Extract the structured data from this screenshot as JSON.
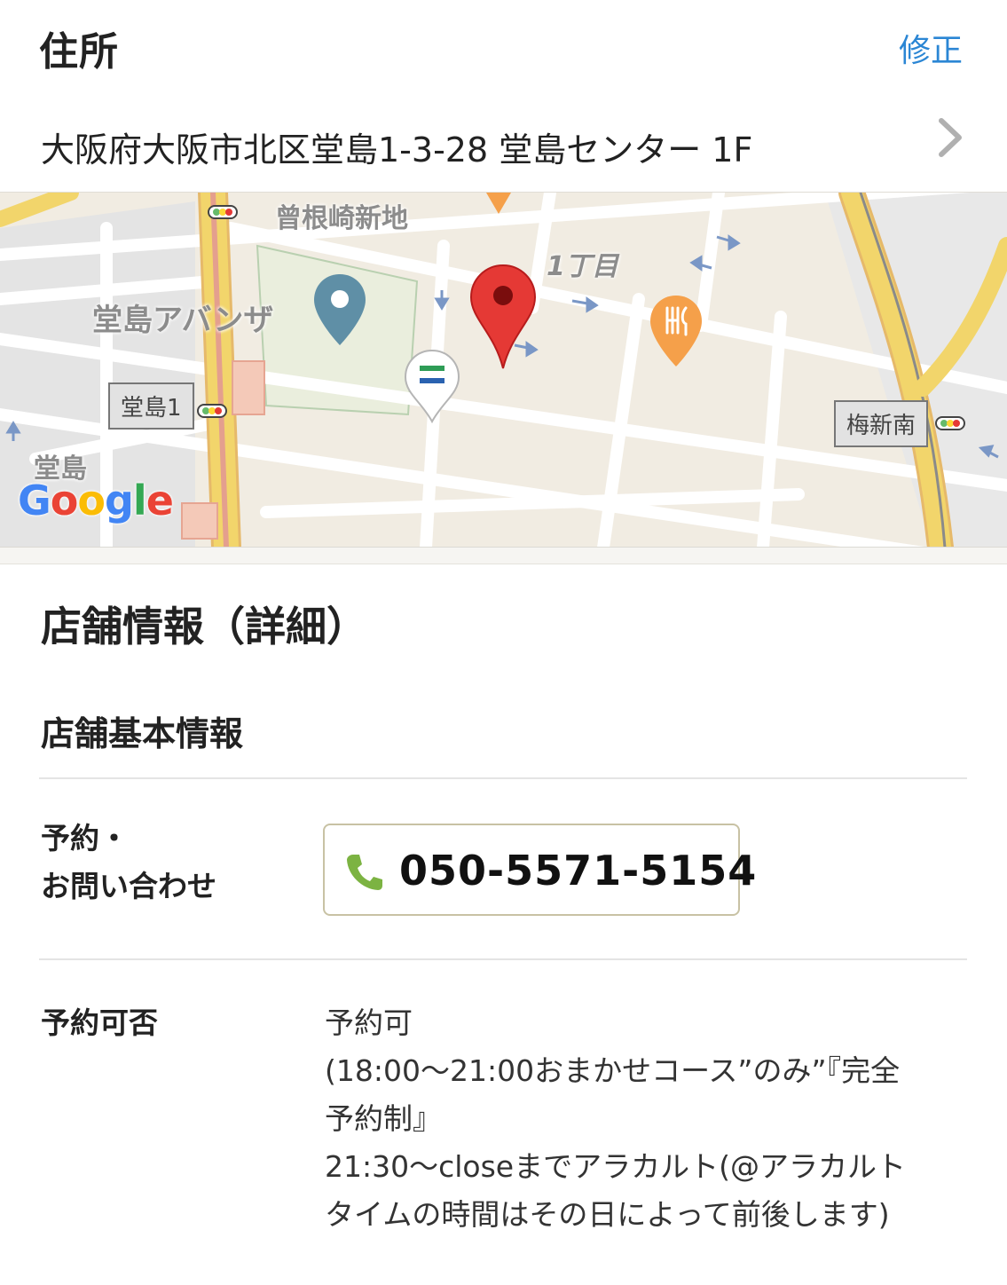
{
  "header": {
    "title": "住所",
    "edit_label": "修正"
  },
  "address": {
    "text": "大阪府大阪市北区堂島1-3-28 堂島センター 1F"
  },
  "map": {
    "labels": {
      "sonezaki": "曾根崎新地",
      "chome": "1丁目",
      "avanza": "堂島アバンザ",
      "dojima": "堂島"
    },
    "stations": {
      "dojima1": "堂島1",
      "umeshinminami": "梅新南"
    },
    "logo": [
      "G",
      "o",
      "o",
      "g",
      "l",
      "e"
    ],
    "colors": {
      "main_pin": "#e53935",
      "poi_pin_blue": "#5f8fa6",
      "restaurant_pin": "#f5a04a",
      "road_major": "#f2d56b",
      "road_minor": "#ffffff"
    },
    "icons": [
      "map-pin-icon",
      "poi-pin-icon",
      "restaurant-pin-icon",
      "convenience-store-pin-icon",
      "traffic-light-icon"
    ]
  },
  "section": {
    "title": "店舗情報（詳細）"
  },
  "subsection": {
    "title": "店舗基本情報"
  },
  "rows": {
    "contact": {
      "label_line1": "予約・",
      "label_line2": "お問い合わせ",
      "phone": "050-5571-5154",
      "icon": "phone-icon",
      "icon_color": "#7cb342"
    },
    "reservation": {
      "label": "予約可否",
      "lines": [
        "予約可",
        "(18:00〜21:00おまかせコース”のみ”『完全",
        "予約制』",
        "21:30〜closeまでアラカルト(@アラカルト",
        "タイムの時間はその日によって前後します)"
      ]
    }
  },
  "accent_color": "#2b86d4"
}
